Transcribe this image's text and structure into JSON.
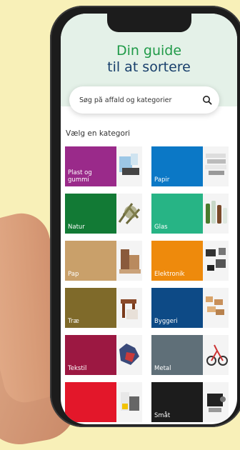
{
  "app": {
    "title_line1": "Din guide",
    "title_line2": "til at sortere"
  },
  "search": {
    "placeholder": "Søg på affald og kategorier",
    "icon": "search-icon"
  },
  "section_label": "Vælg en kategori",
  "colors": {
    "background": "#f8f0b8",
    "header_bg": "#e4f1e8",
    "title_green": "#1f9a48",
    "title_navy": "#173e6b"
  },
  "categories": [
    {
      "label": "Plast og\ngummi",
      "color": "#9a2a8a",
      "icon": "plastic-items-photo"
    },
    {
      "label": "Papir",
      "color": "#0b78c6",
      "icon": "paper-stack-photo"
    },
    {
      "label": "Natur",
      "color": "#127a35",
      "icon": "branches-photo"
    },
    {
      "label": "Glas",
      "color": "#27b485",
      "icon": "glass-bottles-photo"
    },
    {
      "label": "Pap",
      "color": "#c9a06a",
      "icon": "cardboard-photo"
    },
    {
      "label": "Elektronik",
      "color": "#ee8a0c",
      "icon": "electronics-photo"
    },
    {
      "label": "Træ",
      "color": "#7f6a2a",
      "icon": "wood-furniture-photo"
    },
    {
      "label": "Byggeri",
      "color": "#0d4a86",
      "icon": "building-materials-photo"
    },
    {
      "label": "Tekstil",
      "color": "#9c1842",
      "icon": "textiles-photo"
    },
    {
      "label": "Metal",
      "color": "#5f6f78",
      "icon": "metal-items-photo"
    },
    {
      "label": "",
      "color": "#e3172a",
      "icon": "hazardous-photo"
    },
    {
      "label": "Småt",
      "color": "#1c1c1c",
      "icon": "small-items-photo"
    }
  ]
}
